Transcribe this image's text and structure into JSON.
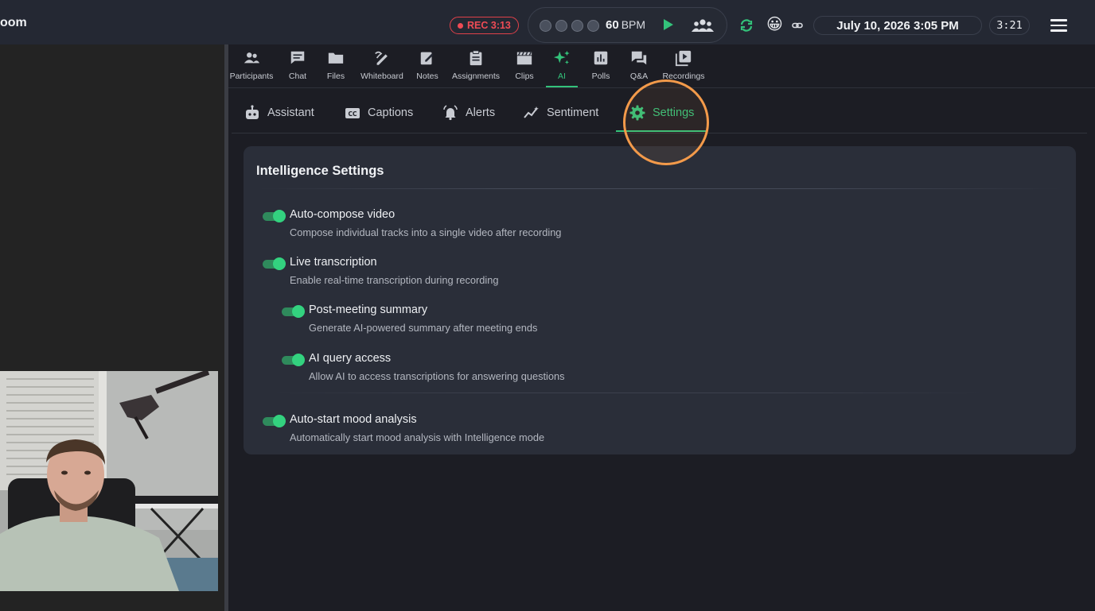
{
  "header": {
    "room_title": "oom",
    "rec_label": "REC 3:13",
    "metronome": {
      "bpm_value": "60",
      "bpm_unit": "BPM",
      "beats": 4
    },
    "emoji": "😀",
    "datetime": "July 10, 2026 3:05 PM",
    "timer": "3:21"
  },
  "toolbar": {
    "items": [
      {
        "id": "participants",
        "label": "Participants"
      },
      {
        "id": "chat",
        "label": "Chat"
      },
      {
        "id": "files",
        "label": "Files"
      },
      {
        "id": "whiteboard",
        "label": "Whiteboard"
      },
      {
        "id": "notes",
        "label": "Notes"
      },
      {
        "id": "assignments",
        "label": "Assignments"
      },
      {
        "id": "clips",
        "label": "Clips"
      },
      {
        "id": "ai",
        "label": "AI",
        "active": true
      },
      {
        "id": "polls",
        "label": "Polls"
      },
      {
        "id": "qa",
        "label": "Q&A"
      },
      {
        "id": "recordings",
        "label": "Recordings"
      }
    ]
  },
  "subtabs": {
    "items": [
      {
        "id": "assistant",
        "label": "Assistant"
      },
      {
        "id": "captions",
        "label": "Captions"
      },
      {
        "id": "alerts",
        "label": "Alerts"
      },
      {
        "id": "sentiment",
        "label": "Sentiment"
      },
      {
        "id": "settings",
        "label": "Settings",
        "active": true
      }
    ]
  },
  "settings": {
    "title": "Intelligence Settings",
    "items": [
      {
        "title": "Auto-compose video",
        "desc": "Compose individual tracks into a single video after recording",
        "enabled": true
      },
      {
        "title": "Live transcription",
        "desc": "Enable real-time transcription during recording",
        "enabled": true
      },
      {
        "title": "Post-meeting summary",
        "desc": "Generate AI-powered summary after meeting ends",
        "enabled": true
      },
      {
        "title": "AI query access",
        "desc": "Allow AI to access transcriptions for answering questions",
        "enabled": true
      },
      {
        "title": "Auto-start mood analysis",
        "desc": "Automatically start mood analysis with Intelligence mode",
        "enabled": true
      }
    ]
  },
  "colors": {
    "accent": "#33c27a",
    "rec": "#ef4b55",
    "highlight": "#f39a4a",
    "card_bg": "#2a2e39",
    "topbar_bg": "#242833"
  }
}
